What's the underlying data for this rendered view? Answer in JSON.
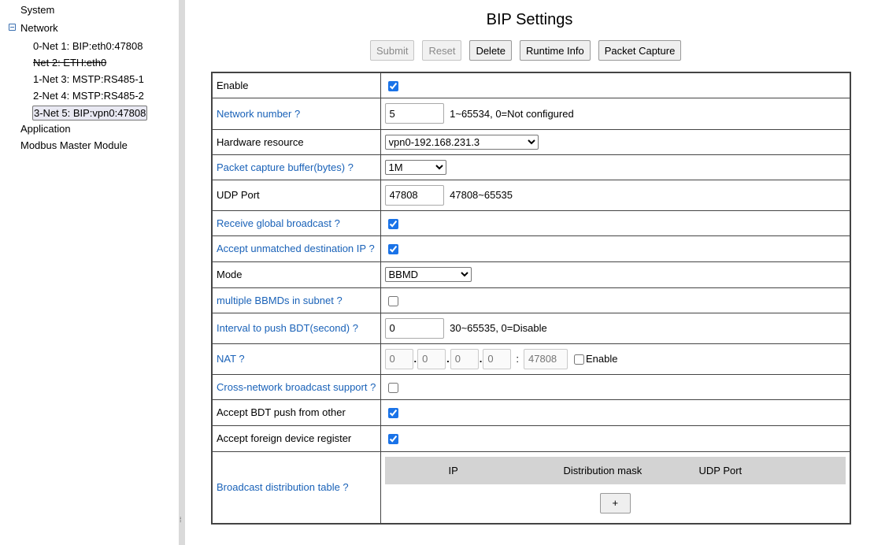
{
  "sidebar": {
    "items": [
      {
        "label": "System"
      },
      {
        "label": "Network"
      },
      {
        "label": "0-Net 1: BIP:eth0:47808"
      },
      {
        "label": "Net 2: ETH:eth0"
      },
      {
        "label": "1-Net 3: MSTP:RS485-1"
      },
      {
        "label": "2-Net 4: MSTP:RS485-2"
      },
      {
        "label": "3-Net 5: BIP:vpn0:47808"
      },
      {
        "label": "Application"
      },
      {
        "label": "Modbus Master Module"
      }
    ],
    "collapse_icon": "minus-box-icon",
    "splitter_grip": "⁞"
  },
  "page": {
    "title": "BIP Settings"
  },
  "toolbar": {
    "submit": "Submit",
    "reset": "Reset",
    "delete": "Delete",
    "runtime_info": "Runtime Info",
    "packet_capture": "Packet Capture"
  },
  "form": {
    "enable": {
      "label": "Enable",
      "checked": true
    },
    "network_number": {
      "label": "Network number ?",
      "value": "5",
      "hint": "1~65534, 0=Not configured"
    },
    "hardware_resource": {
      "label": "Hardware resource",
      "value": "vpn0-192.168.231.3"
    },
    "packet_buffer": {
      "label": "Packet capture buffer(bytes) ?",
      "value": "1M"
    },
    "udp_port": {
      "label": "UDP Port",
      "value": "47808",
      "hint": "47808~65535"
    },
    "receive_global_broadcast": {
      "label": "Receive global broadcast ?",
      "checked": true
    },
    "accept_unmatched_ip": {
      "label": "Accept unmatched destination IP ?",
      "checked": true
    },
    "mode": {
      "label": "Mode",
      "value": "BBMD"
    },
    "multiple_bbmds": {
      "label": "multiple BBMDs in subnet ?",
      "checked": false
    },
    "push_interval": {
      "label": "Interval to push BDT(second) ?",
      "value": "0",
      "hint": "30~65535, 0=Disable"
    },
    "nat": {
      "label": "NAT ?",
      "ip1_placeholder": "0",
      "ip2_placeholder": "0",
      "ip3_placeholder": "0",
      "ip4_placeholder": "0",
      "port_placeholder": "47808",
      "dot": ".",
      "colon": ":",
      "enable_label": "Enable",
      "enable_checked": false
    },
    "cross_network_broadcast": {
      "label": "Cross-network broadcast support ?",
      "checked": false
    },
    "accept_bdt_push": {
      "label": "Accept BDT push from other",
      "checked": true
    },
    "accept_foreign_device": {
      "label": "Accept foreign device register",
      "checked": true
    },
    "bdt": {
      "label": "Broadcast distribution table ?",
      "col_ip": "IP",
      "col_mask": "Distribution mask",
      "col_port": "UDP Port",
      "add_label": "+"
    }
  },
  "colors": {
    "link": "#1a62b8",
    "table_header_bg": "#d3d3d3",
    "splitter": "#dadada"
  }
}
